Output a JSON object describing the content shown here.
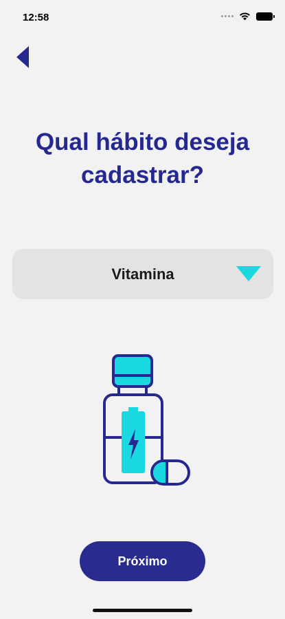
{
  "status_bar": {
    "time": "12:58",
    "icons": [
      "signal-dots-icon",
      "wifi-icon",
      "battery-icon"
    ]
  },
  "navigation": {
    "back_icon": "back-arrow-icon"
  },
  "title": "Qual hábito deseja cadastrar?",
  "habit_select": {
    "selected_value": "Vitamina",
    "dropdown_icon": "triangle-down-icon"
  },
  "illustration": {
    "icon": "vitamin-bottle-icon"
  },
  "next_button": {
    "label": "Próximo"
  },
  "colors": {
    "background": "#f2f2f2",
    "primary": "#2a2b8f",
    "title": "#25288f",
    "accent": "#1ad8e0",
    "select_bg": "#e3e3e3"
  }
}
